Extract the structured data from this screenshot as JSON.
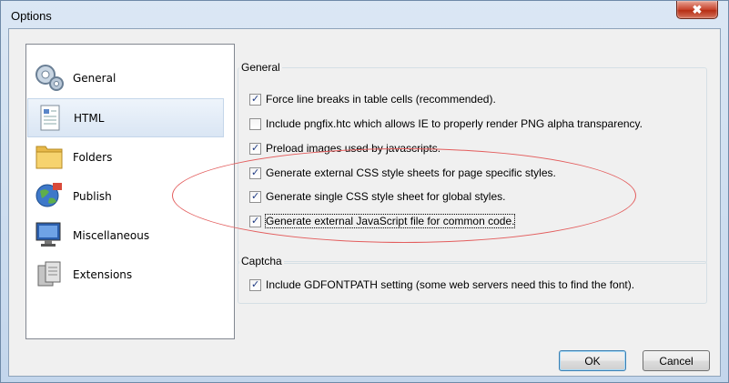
{
  "window": {
    "title": "Options",
    "close_glyph": "✖"
  },
  "sidebar": {
    "items": [
      {
        "label": "General",
        "icon": "gears-icon",
        "selected": false
      },
      {
        "label": "HTML",
        "icon": "html-document-icon",
        "selected": true
      },
      {
        "label": "Folders",
        "icon": "folder-icon",
        "selected": false
      },
      {
        "label": "Publish",
        "icon": "globe-publish-icon",
        "selected": false
      },
      {
        "label": "Miscellaneous",
        "icon": "monitor-icon",
        "selected": false
      },
      {
        "label": "Extensions",
        "icon": "extensions-icon",
        "selected": false
      }
    ]
  },
  "general_group": {
    "title": "General",
    "options": [
      {
        "label": "Force line breaks in table cells (recommended).",
        "checked": true
      },
      {
        "label": "Include pngfix.htc which allows IE to properly render PNG alpha transparency.",
        "checked": false
      },
      {
        "label": "Preload images used by javascripts.",
        "checked": true
      },
      {
        "label": "Generate external CSS style sheets for page specific styles.",
        "checked": true
      },
      {
        "label": "Generate single CSS style sheet for global styles.",
        "checked": true
      },
      {
        "label": "Generate external JavaScript file for common code.",
        "checked": true
      }
    ]
  },
  "captcha_group": {
    "title": "Captcha",
    "options": [
      {
        "label": "Include GDFONTPATH setting (some web servers need this to find the font).",
        "checked": true
      }
    ]
  },
  "buttons": {
    "ok": "OK",
    "cancel": "Cancel"
  },
  "colors": {
    "annotation_ellipse": "#e35d5d",
    "selection": "#dae6f4"
  }
}
